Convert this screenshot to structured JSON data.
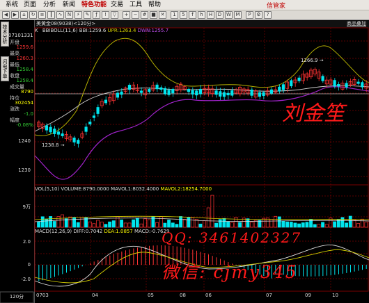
{
  "menubar": {
    "items": [
      "系统",
      "页面",
      "分析",
      "新闻",
      "特色功能",
      "交易",
      "工具",
      "帮助"
    ],
    "brand": "信管家"
  },
  "chart_header": {
    "symbol": "美黄金08(9038)<120分>",
    "link": "商品叠加"
  },
  "sidebar": {
    "tabs": [
      "技术分析",
      "闪电下单"
    ],
    "time": "07101331",
    "rows": [
      {
        "label": "开盘",
        "value": "1259.6",
        "color": "#ff3333"
      },
      {
        "label": "最高",
        "value": "1260.3",
        "color": "#ff3333"
      },
      {
        "label": "最低",
        "value": "1258.4",
        "color": "#33cc33"
      },
      {
        "label": "收盘",
        "value": "1258.4",
        "color": "#33cc33"
      },
      {
        "label": "成交量",
        "value": "8790",
        "color": "#ffff00"
      },
      {
        "label": "持仓",
        "value": "302454",
        "color": "#ffff00"
      },
      {
        "label": "涨跌",
        "value": "-1.0",
        "color": "#33cc33"
      },
      {
        "label": "幅度",
        "value": "-0.08%",
        "color": "#33cc33"
      }
    ]
  },
  "indicators": {
    "boll": {
      "prefix": "K",
      "name": "BBIBOLL(11,6)",
      "bbi": "BBI:1259.6",
      "upr": "UPR:1263.4",
      "dwn": "DWN:1255.7"
    },
    "vol": {
      "name": "VOL(5,10)",
      "volume": "VOLUME:8790.0000",
      "mavol1": "MAVOL1:8032.4000",
      "mavol2": "MAVOL2:18254.7000"
    },
    "macd": {
      "name": "MACD(12,26,9)",
      "diff": "DIFF:0.7042",
      "dea": "DEA:1.0857",
      "macd": "MACD:-0.7629"
    }
  },
  "price_axis": [
    "1240",
    "1230"
  ],
  "vol_axis": [
    "9万"
  ],
  "macd_axis": [
    "2.0",
    "0",
    "-2.0"
  ],
  "annotations": {
    "high": "1266.9",
    "low": "1238.8"
  },
  "date_axis": [
    "0703",
    "04",
    "05",
    "06",
    "07",
    "08",
    "09",
    "10"
  ],
  "period": "120分",
  "watermark": {
    "name": "刘金笙",
    "qq": "QQ: 3461402327",
    "wechat": "微信: cjmy345"
  },
  "colors": {
    "boll_upper": "#b5b000",
    "boll_lower": "#9f23c9",
    "boll_mid": "#cfcfcf",
    "up": "#ff3333",
    "down": "#00e5ee",
    "grid": "#7a0000"
  }
}
